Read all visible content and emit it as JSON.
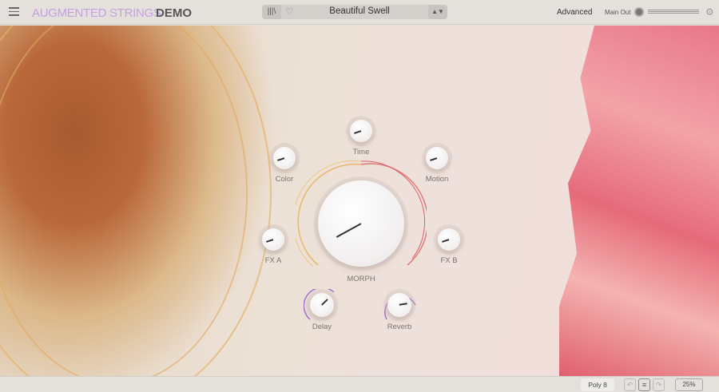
{
  "header": {
    "title": "AUGMENTED STRINGS",
    "edition": "DEMO",
    "preset_name": "Beautiful Swell",
    "library_icon": "library-icon",
    "favorite_icon": "heart-icon",
    "preset_arrows": "▲▼",
    "advanced_label": "Advanced",
    "main_out_label": "Main Out"
  },
  "knobs": [
    {
      "id": "time",
      "label": "Time",
      "value": 0.1
    },
    {
      "id": "color",
      "label": "Color",
      "value": 0.1
    },
    {
      "id": "motion",
      "label": "Motion",
      "value": 0.1
    },
    {
      "id": "fx-a",
      "label": "FX A",
      "value": 0.1
    },
    {
      "id": "fx-b",
      "label": "FX B",
      "value": 0.1
    },
    {
      "id": "morph",
      "label": "MORPH",
      "value": 0.06
    },
    {
      "id": "delay",
      "label": "Delay",
      "value": 0.67
    },
    {
      "id": "reverb",
      "label": "Reverb",
      "value": 0.8
    }
  ],
  "status": {
    "poly": "Poly 8",
    "zoom": "25%"
  },
  "colors": {
    "title": "#c5a0e0",
    "arc_warm": "#e8b060",
    "arc_red": "#d86070",
    "arc_purple": "#a070d0"
  }
}
